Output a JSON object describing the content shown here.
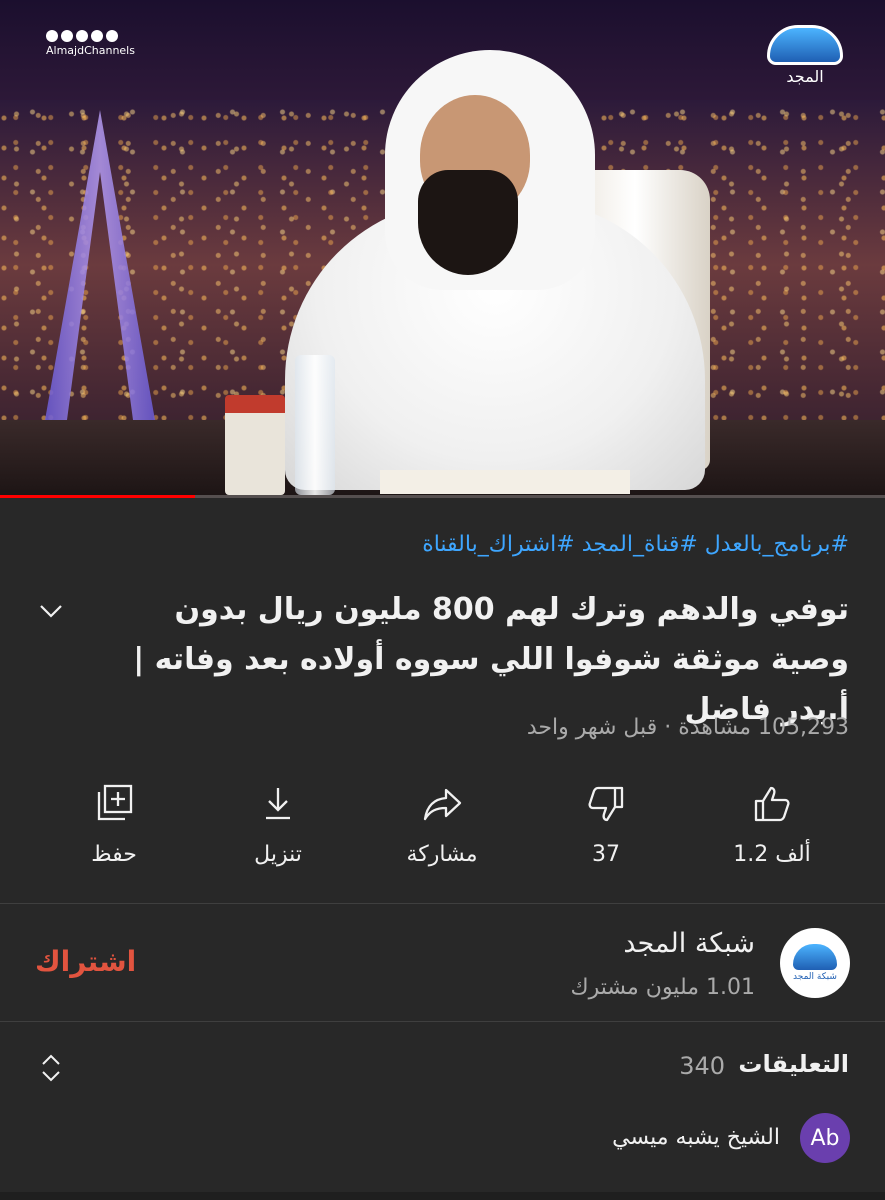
{
  "video": {
    "watermark_handle": "AlmajdChannels",
    "channel_logo_text": "المجد",
    "progress_fraction": 0.22
  },
  "details": {
    "hashtags": "#برنامج_بالعدل #قناة_المجد #اشتراك_بالقناة",
    "title": "توفي والدهم وترك لهم 800 مليون ريال بدون وصية موثقة شوفوا اللي سووه أولاده بعد وفاته | أ.بدر فاضل",
    "views": "105,293 مشاهدة",
    "separator": "·",
    "uploaded": "قبل شهر واحد"
  },
  "actions": {
    "like": "1.2 ألف",
    "dislike": "37",
    "share": "مشاركة",
    "download": "تنزيل",
    "save": "حفظ"
  },
  "channel": {
    "name": "شبكة المجد",
    "subscribers": "1.01 مليون مشترك",
    "subscribe_label": "اشتراك",
    "avatar_text": "شبكة المجد"
  },
  "comments": {
    "label": "التعليقات",
    "count": "340",
    "first_avatar": "Ab",
    "first_text": "الشيخ يشبه ميسي"
  },
  "colors": {
    "background": "#282828",
    "hashtag": "#3ea6ff",
    "subscribe": "#e2543f",
    "progress": "#ff0000"
  }
}
